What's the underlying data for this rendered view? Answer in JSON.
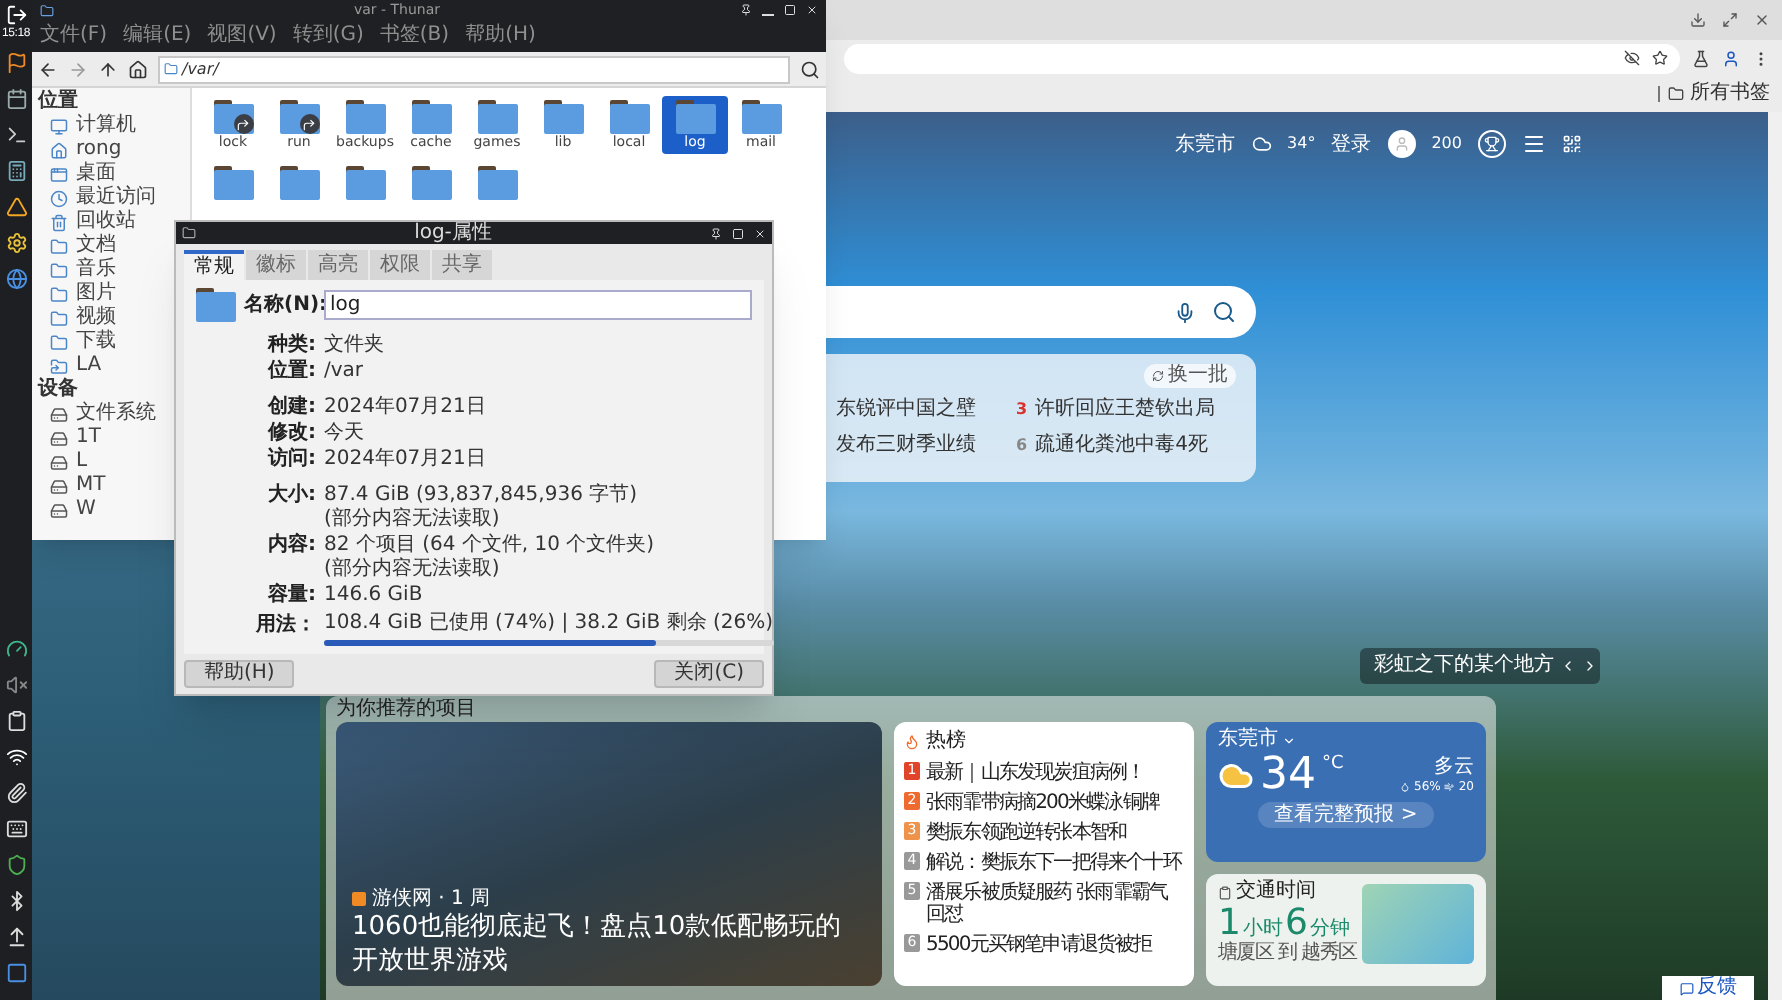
{
  "dock": {
    "time": "15:18"
  },
  "thunar": {
    "title": "var - Thunar",
    "menu": [
      "文件(F)",
      "编辑(E)",
      "视图(V)",
      "转到(G)",
      "书签(B)",
      "帮助(H)"
    ],
    "path": "/var/",
    "sidebar": [
      {
        "title": "位置",
        "items": [
          {
            "label": "计算机",
            "kind": "computer"
          },
          {
            "label": "rong",
            "kind": "home"
          },
          {
            "label": "桌面",
            "kind": "desktop"
          },
          {
            "label": "最近访问",
            "kind": "recent"
          },
          {
            "label": "回收站",
            "kind": "trash"
          },
          {
            "label": "文档",
            "kind": "folder"
          },
          {
            "label": "音乐",
            "kind": "folder"
          },
          {
            "label": "图片",
            "kind": "folder"
          },
          {
            "label": "视频",
            "kind": "folder"
          },
          {
            "label": "下载",
            "kind": "folder"
          },
          {
            "label": "LA",
            "kind": "network"
          }
        ]
      },
      {
        "title": "设备",
        "items": [
          {
            "label": "文件系统",
            "kind": "drive"
          },
          {
            "label": "1T",
            "kind": "drive"
          },
          {
            "label": "L",
            "kind": "drive"
          },
          {
            "label": "MT",
            "kind": "drive"
          },
          {
            "label": "W",
            "kind": "drive"
          }
        ]
      }
    ],
    "folders": [
      {
        "name": "lock",
        "link": true,
        "selected": false
      },
      {
        "name": "run",
        "link": true,
        "selected": false
      },
      {
        "name": "backups",
        "link": false,
        "selected": false
      },
      {
        "name": "cache",
        "link": false,
        "selected": false
      },
      {
        "name": "games",
        "link": false,
        "selected": false
      },
      {
        "name": "lib",
        "link": false,
        "selected": false
      },
      {
        "name": "local",
        "link": false,
        "selected": false
      },
      {
        "name": "log",
        "link": false,
        "selected": true
      },
      {
        "name": "mail",
        "link": false,
        "selected": false
      }
    ]
  },
  "dialog": {
    "title": "log-属性",
    "tabs": [
      {
        "label": "常规",
        "selected": true
      },
      {
        "label": "徽标",
        "selected": false
      },
      {
        "label": "高亮",
        "selected": false
      },
      {
        "label": "权限",
        "selected": false
      },
      {
        "label": "共享",
        "selected": false
      }
    ],
    "name_label": "名称(N):",
    "name_value": "log",
    "field_groups": [
      [
        {
          "label": "种类:",
          "value": "文件夹"
        },
        {
          "label": "位置:",
          "value": "/var"
        }
      ],
      [
        {
          "label": "创建:",
          "value": "2024年07月21日"
        },
        {
          "label": "修改:",
          "value": "今天"
        },
        {
          "label": "访问:",
          "value": "2024年07月21日"
        }
      ],
      [
        {
          "label": "大小:",
          "value": "87.4 GiB (93,837,845,936 字节)",
          "note": "(部分内容无法读取)"
        },
        {
          "label": "内容:",
          "value": "82 个项目 (64 个文件, 10 个文件夹)",
          "note": "(部分内容无法读取)"
        },
        {
          "label": "容量:",
          "value": "146.6 GiB"
        }
      ]
    ],
    "usage": {
      "label": "用法：",
      "text": "108.4 GiB 已使用 (74%) | 38.2 GiB 剩余 (26%)",
      "level": 0.74
    },
    "buttons": [
      "帮助(H)",
      "关闭(C)"
    ]
  },
  "browser": {
    "bookmarks": "所有书签",
    "topbar": {
      "city": "东莞市",
      "temp": "34°",
      "login": "登录",
      "points": "200"
    },
    "hot_search": {
      "refresh": "换一批",
      "items": [
        {
          "text": "东锐评中国之壁"
        },
        {
          "rank": "3",
          "text": "许昕回应王楚钦出局",
          "color": "#d9312b"
        },
        {
          "text": "发布三财季业绩"
        },
        {
          "rank": "6",
          "text": "疏通化粪池中毒4死",
          "color": "#888888"
        }
      ]
    },
    "location": "彩虹之下的某个地方",
    "section_title": "为你推荐的项目",
    "news": {
      "source": "游侠网 · 1 周",
      "title": "1060也能彻底起飞！盘点10款低配畅玩的开放世界游戏"
    },
    "hot_list": {
      "title": "热榜",
      "items": [
        {
          "rank": "1",
          "text": "最新｜山东发现炭疽病例！",
          "color": "#e0452a"
        },
        {
          "rank": "2",
          "text": "张雨霏带病摘200米蝶泳铜牌",
          "color": "#ef6a2f"
        },
        {
          "rank": "3",
          "text": "樊振东领跑逆转张本智和",
          "color": "#f0934a"
        },
        {
          "rank": "4",
          "text": "解说：樊振东下一把得来个十环",
          "color": "#999999"
        },
        {
          "rank": "5",
          "text": "潘展乐被质疑服药 张雨霏霸气回怼",
          "color": "#999999"
        },
        {
          "rank": "6",
          "text": "5500元买钢笔申请退货被拒",
          "color": "#999999"
        }
      ]
    },
    "weather": {
      "city": "东莞市",
      "temp": "34",
      "unit": "°C",
      "condition": "多云",
      "humidity": "56%",
      "wind": "20",
      "link": "查看完整预报 >"
    },
    "traffic": {
      "title": "交通时间",
      "hours": "1",
      "hours_unit": "小时",
      "minutes": "6",
      "minutes_unit": "分钟",
      "route": "塘厦区 到 越秀区"
    },
    "feedback": "反馈"
  }
}
